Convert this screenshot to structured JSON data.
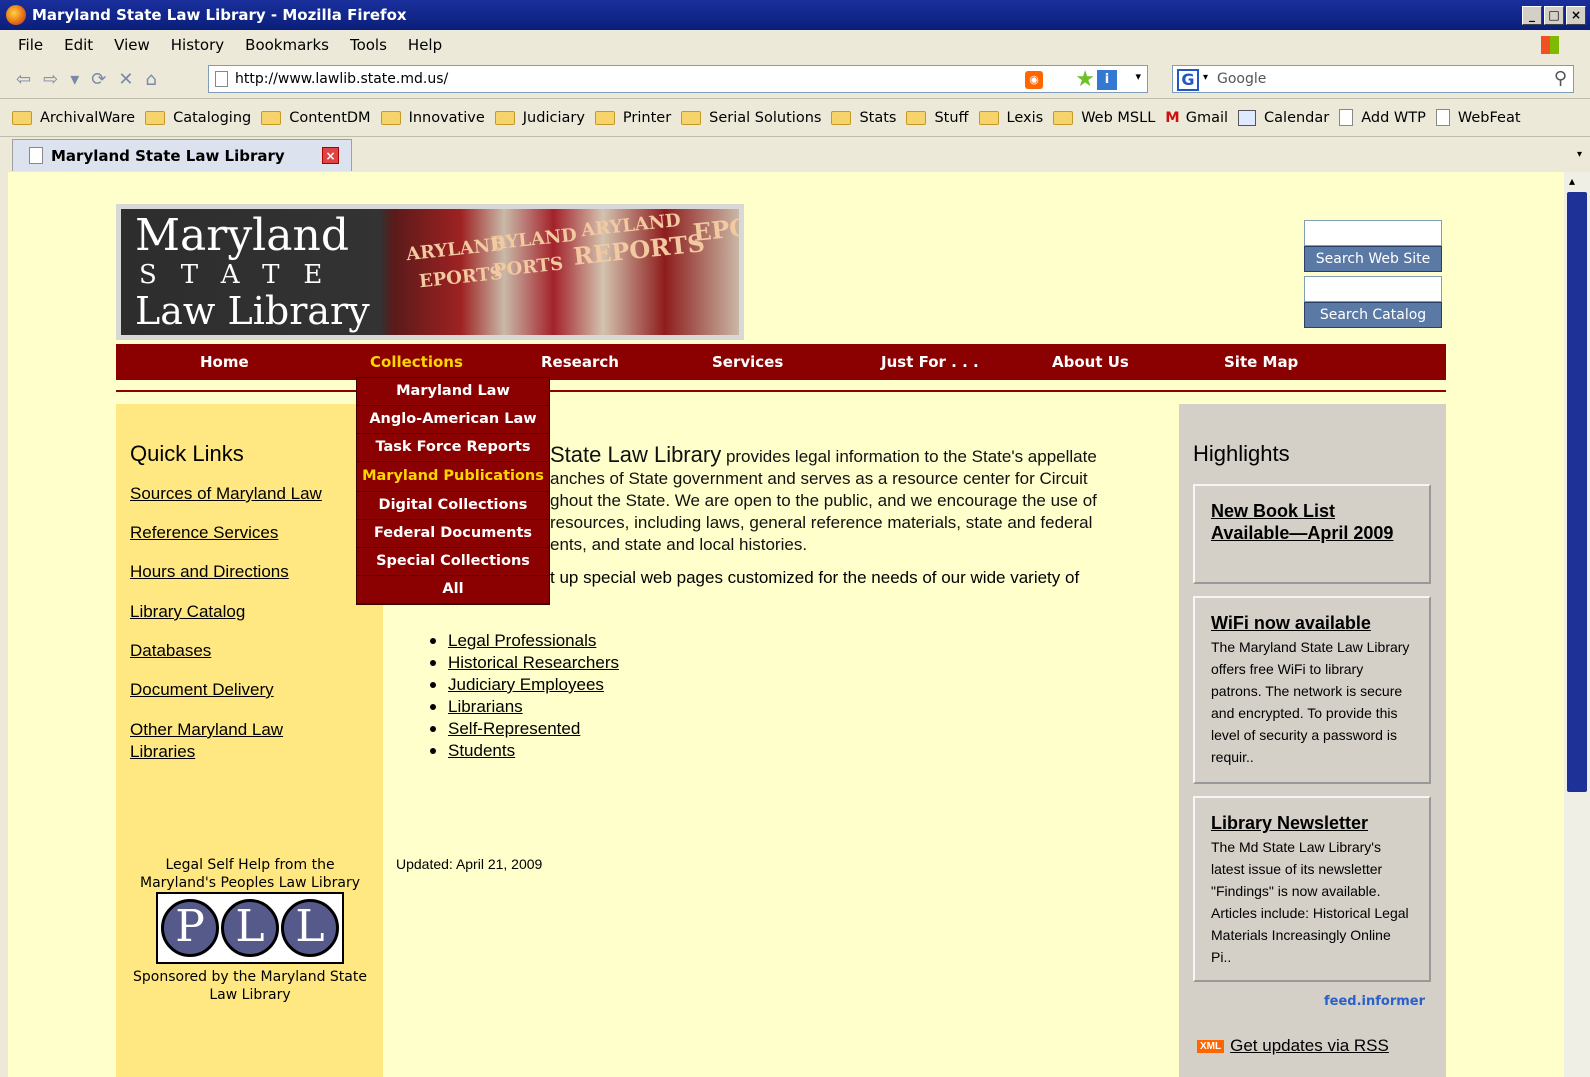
{
  "window": {
    "title": "Maryland State Law Library - Mozilla Firefox"
  },
  "menu": [
    "File",
    "Edit",
    "View",
    "History",
    "Bookmarks",
    "Tools",
    "Help"
  ],
  "url": "http://www.lawlib.state.md.us/",
  "search_placeholder": "Google",
  "bookmarks": [
    "ArchivalWare",
    "Cataloging",
    "ContentDM",
    "Innovative",
    "Judiciary",
    "Printer",
    "Serial Solutions",
    "Stats",
    "Stuff",
    "Lexis",
    "Web MSLL",
    "Gmail",
    "Calendar",
    "Add WTP",
    "WebFeat"
  ],
  "tab": {
    "label": "Maryland State Law Library"
  },
  "logo": {
    "line1": "Maryland",
    "line2": "STATE",
    "line3": "Law Library",
    "books": [
      "ARYLAND",
      "EPORTS",
      "RYLAND",
      "PORTS",
      "ARYLAND",
      "REPORTS",
      "EPO"
    ]
  },
  "site_search": {
    "search_label": "Search Web Site",
    "catalog_label": "Search Catalog"
  },
  "nav": [
    "Home",
    "Collections",
    "Research",
    "Services",
    "Just For . . .",
    "About Us",
    "Site Map"
  ],
  "dropdown": [
    "Maryland Law",
    "Anglo-American Law",
    "Task Force Reports",
    "Maryland Publications",
    "Digital Collections",
    "Federal Documents",
    "Special Collections",
    "All"
  ],
  "quick_links": {
    "title": "Quick Links",
    "items": [
      "Sources of Maryland Law",
      "Reference Services",
      "Hours and Directions",
      "Library Catalog",
      "Databases",
      "Document Delivery",
      "Other Maryland Law Libraries"
    ]
  },
  "pll": {
    "caption": "Legal Self Help from the Maryland's Peoples Law Library",
    "sponsor": "Sponsored by the Maryland State Law Library",
    "letters": [
      "P",
      "L",
      "L"
    ]
  },
  "main": {
    "intro_lead": "State Law Library",
    "intro_rest": "provides legal information to the State's appellate",
    "intro_l2": "anches of State government and serves as a resource center for Circuit",
    "intro_l3": "ghout the State. We are open to the public, and we encourage the use of",
    "intro_l4": "resources, including laws, general reference materials, state and federal",
    "intro_l5": "ents, and state and local histories.",
    "intro2": "t up special web pages customized for the needs of our wide variety of",
    "audiences": [
      "Legal Professionals",
      "Historical Researchers",
      "Judiciary Employees",
      "Librarians",
      "Self-Represented",
      "Students"
    ],
    "updated": "Updated: April 21, 2009"
  },
  "highlights": {
    "title": "Highlights",
    "items": [
      {
        "title": "New Book List Available—April 2009",
        "text": ""
      },
      {
        "title": "WiFi now available",
        "text": "The Maryland State Law Library offers free WiFi to library patrons. The network is secure and encrypted. To provide this level of security a password is requir.."
      },
      {
        "title": "Library Newsletter",
        "text": "The Md State Law Library's latest issue of its newsletter \"Findings\" is now available. Articles include: Historical Legal Materials Increasingly Online Pi.."
      }
    ],
    "feed": "feed.informer",
    "rss_badge": "XML",
    "rss": "Get updates via RSS"
  }
}
